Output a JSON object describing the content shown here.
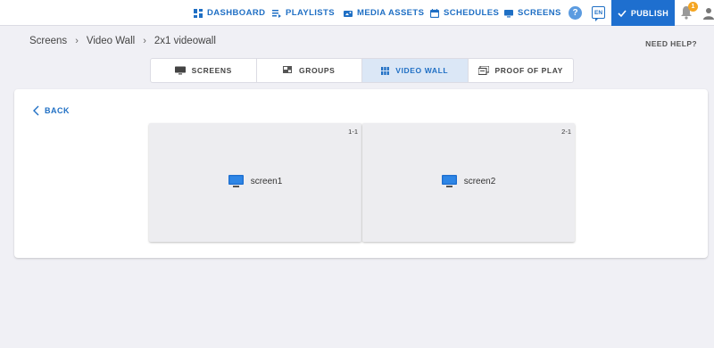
{
  "nav": {
    "items": [
      {
        "label": "DASHBOARD",
        "icon": "dashboard-icon"
      },
      {
        "label": "PLAYLISTS",
        "icon": "playlist-icon"
      },
      {
        "label": "MEDIA ASSETS",
        "icon": "media-icon"
      },
      {
        "label": "SCHEDULES",
        "icon": "calendar-icon"
      },
      {
        "label": "SCREENS",
        "icon": "monitor-icon"
      }
    ],
    "help_symbol": "?",
    "language": "EN",
    "publish_label": "PUBLISH",
    "notification_count": "1"
  },
  "breadcrumb": [
    "Screens",
    "Video Wall",
    "2x1 videowall"
  ],
  "need_help": "NEED HELP?",
  "tabs": [
    {
      "label": "SCREENS",
      "icon": "monitor-icon",
      "active": false
    },
    {
      "label": "GROUPS",
      "icon": "groups-icon",
      "active": false
    },
    {
      "label": "VIDEO WALL",
      "icon": "grid-icon",
      "active": true
    },
    {
      "label": "PROOF OF PLAY",
      "icon": "proof-icon",
      "active": false
    }
  ],
  "back_label": "BACK",
  "videowall": {
    "screens": [
      {
        "position": "1-1",
        "name": "screen1"
      },
      {
        "position": "2-1",
        "name": "screen2"
      }
    ]
  },
  "colors": {
    "accent": "#1e6fcf",
    "badge": "#f5a623",
    "active_tab": "#dbe7f6"
  }
}
